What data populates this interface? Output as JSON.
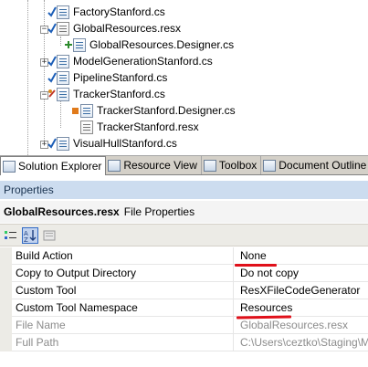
{
  "solution_tree": {
    "items": [
      {
        "label": "FactoryStanford.cs",
        "expander": "",
        "status": "check"
      },
      {
        "label": "GlobalResources.resx",
        "expander": "−",
        "status": "check"
      },
      {
        "label": "GlobalResources.Designer.cs",
        "expander": "",
        "status": "add"
      },
      {
        "label": "ModelGenerationStanford.cs",
        "expander": "+",
        "status": "check"
      },
      {
        "label": "PipelineStanford.cs",
        "expander": "",
        "status": "check"
      },
      {
        "label": "TrackerStanford.cs",
        "expander": "−",
        "status": "edit"
      },
      {
        "label": "TrackerStanford.Designer.cs",
        "expander": "",
        "status": "pending"
      },
      {
        "label": "TrackerStanford.resx",
        "expander": "",
        "status": "none"
      },
      {
        "label": "VisualHullStanford.cs",
        "expander": "+",
        "status": "check"
      }
    ]
  },
  "tabs": [
    {
      "label": "Solution Explorer",
      "active": true
    },
    {
      "label": "Resource View",
      "active": false
    },
    {
      "label": "Toolbox",
      "active": false
    },
    {
      "label": "Document Outline",
      "active": false
    }
  ],
  "properties": {
    "title": "Properties",
    "object_name": "GlobalResources.resx",
    "object_type": "File Properties",
    "rows": [
      {
        "name": "Build Action",
        "value": "None",
        "readonly": false,
        "highlighted": true
      },
      {
        "name": "Copy to Output Directory",
        "value": "Do not copy",
        "readonly": false,
        "highlighted": false
      },
      {
        "name": "Custom Tool",
        "value": "ResXFileCodeGenerator",
        "readonly": false,
        "highlighted": false
      },
      {
        "name": "Custom Tool Namespace",
        "value": "Resources",
        "readonly": false,
        "highlighted": true
      },
      {
        "name": "File Name",
        "value": "GlobalResources.resx",
        "readonly": true,
        "highlighted": false
      },
      {
        "name": "Full Path",
        "value": "C:\\Users\\ceztko\\Staging\\M",
        "readonly": true,
        "highlighted": false
      }
    ]
  },
  "colors": {
    "highlight_underline": "#e0101a",
    "check_green": "#2c8a2c",
    "check_blue": "#1d5fb8",
    "props_title_bg": "#ccdcef"
  }
}
